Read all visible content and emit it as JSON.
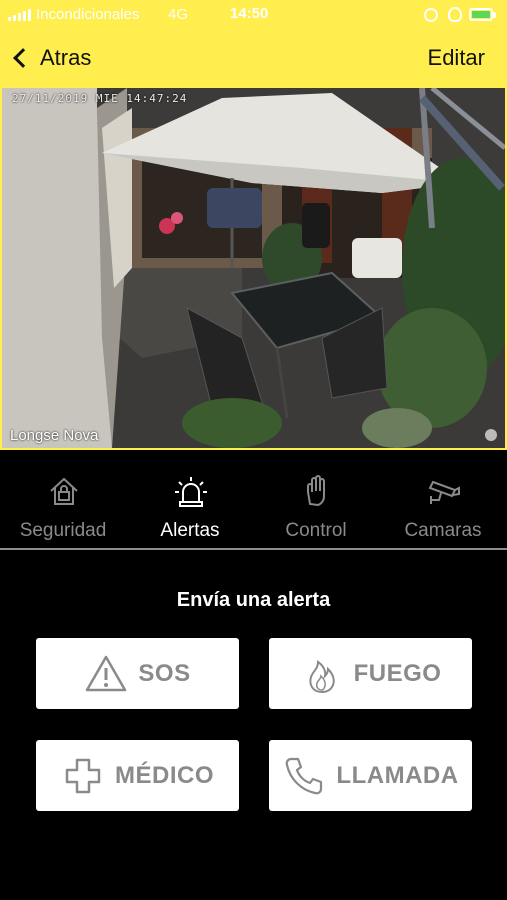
{
  "status_bar": {
    "carrier": "Incondicionales",
    "network": "4G",
    "time": "14:50"
  },
  "nav": {
    "back_label": "Atras",
    "edit_label": "Editar"
  },
  "camera": {
    "timestamp": "27/11/2019 MIE 14:47:24",
    "name": "Longse Nova"
  },
  "tabs": [
    {
      "label": "Seguridad",
      "icon": "house-lock-icon",
      "active": false
    },
    {
      "label": "Alertas",
      "icon": "siren-icon",
      "active": true
    },
    {
      "label": "Control",
      "icon": "hand-icon",
      "active": false
    },
    {
      "label": "Camaras",
      "icon": "cctv-camera-icon",
      "active": false
    }
  ],
  "alerts": {
    "title": "Envía una alerta",
    "buttons": [
      {
        "label": "SOS",
        "icon": "warning-triangle-icon"
      },
      {
        "label": "FUEGO",
        "icon": "fire-icon"
      },
      {
        "label": "MÉDICO",
        "icon": "medical-cross-icon"
      },
      {
        "label": "LLAMADA",
        "icon": "phone-icon"
      }
    ]
  },
  "colors": {
    "accent": "#ffee4d",
    "background": "#000000",
    "button": "#ffffff",
    "button_text": "#8a8a8a",
    "tab_inactive": "#8a8a8a"
  }
}
